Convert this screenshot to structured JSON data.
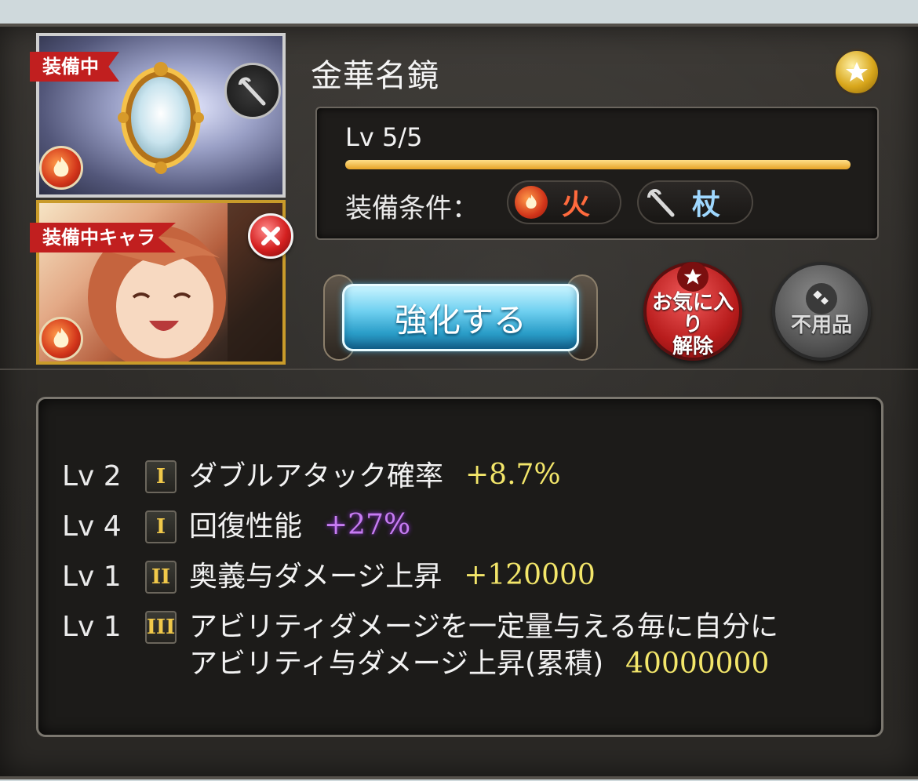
{
  "weapon": {
    "name": "金華名鏡",
    "equipped_label": "装備中",
    "level_text": "Lv 5/5",
    "level_progress": 1.0,
    "element_icon": "fire-element-icon",
    "type_icon": "staff-icon"
  },
  "character": {
    "equipped_label": "装備中キャラ",
    "element_icon": "fire-element-icon"
  },
  "equip_conditions": {
    "label": "装備条件：",
    "element": "火",
    "weapon_type": "杖"
  },
  "buttons": {
    "upgrade": "強化する",
    "unfavorite": "お気に入り解除",
    "junk": "不用品"
  },
  "skills": [
    {
      "lv": "Lv 2",
      "tier": "I",
      "name": "ダブルアタック確率",
      "value": "+8.7%",
      "value_color": "#f3e66a"
    },
    {
      "lv": "Lv 4",
      "tier": "I",
      "name": "回復性能",
      "value": "+27%",
      "value_color": "#c77cf3"
    },
    {
      "lv": "Lv 1",
      "tier": "II",
      "name": "奥義与ダメージ上昇",
      "value": "+120000",
      "value_color": "#f3e66a"
    },
    {
      "lv": "Lv 1",
      "tier": "III",
      "name_line1": "アビリティダメージを一定量与える毎に自分に",
      "name_line2": "アビリティ与ダメージ上昇(累積)",
      "value": "40000000",
      "value_color": "#f3e66a"
    }
  ],
  "colors": {
    "ribbon_red": "#c11f1f",
    "level_bar": "#e6a225",
    "fire_text": "#ff6a3d",
    "staff_text": "#9fd8ff"
  }
}
